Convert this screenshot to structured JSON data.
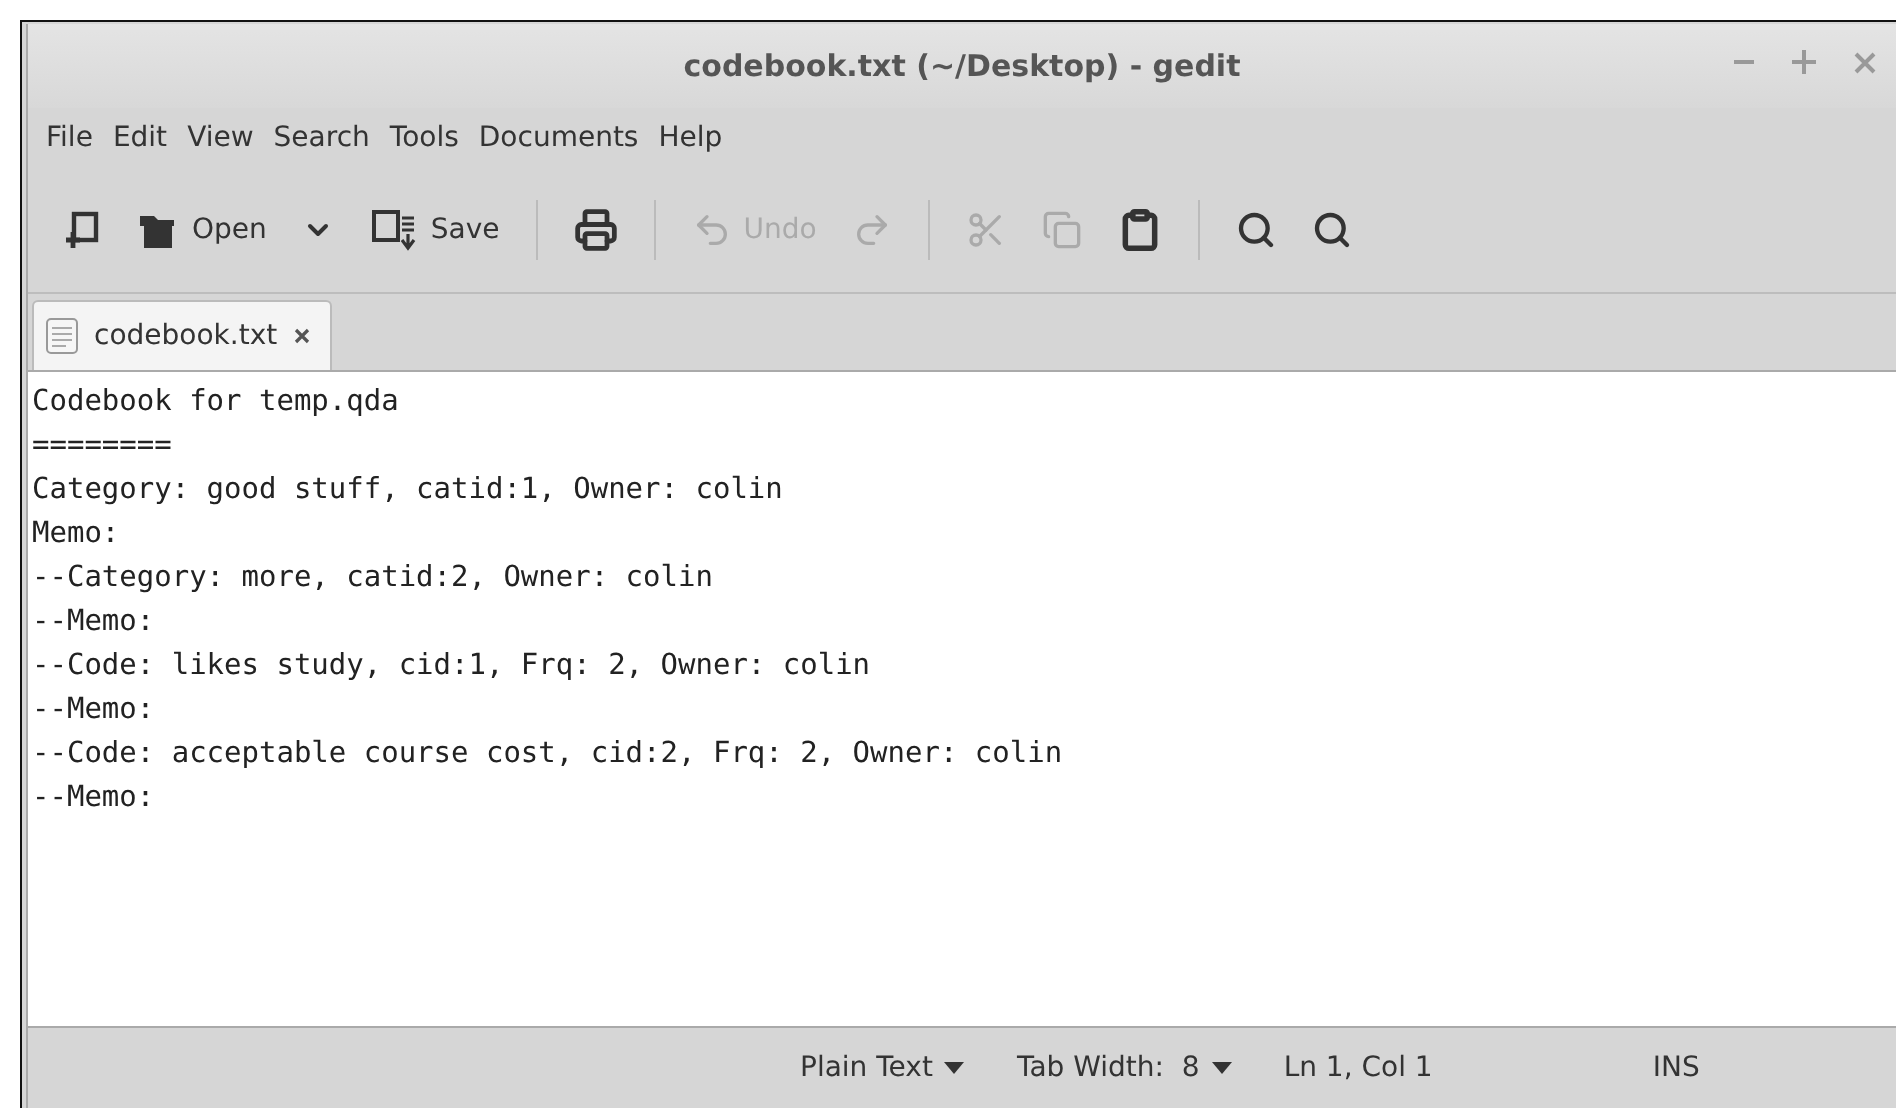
{
  "window": {
    "title": "codebook.txt (~/Desktop) - gedit"
  },
  "menu": [
    "File",
    "Edit",
    "View",
    "Search",
    "Tools",
    "Documents",
    "Help"
  ],
  "toolbar": [
    {
      "kind": "new",
      "disabled": false
    },
    {
      "kind": "open",
      "label": "Open",
      "disabled": false
    },
    {
      "kind": "dropdown",
      "disabled": false
    },
    {
      "kind": "save",
      "label": "Save",
      "disabled": false
    },
    {
      "kind": "separator"
    },
    {
      "kind": "print",
      "disabled": false
    },
    {
      "kind": "separator"
    },
    {
      "kind": "undo",
      "label": "Undo",
      "disabled": true
    },
    {
      "kind": "redo",
      "disabled": true
    },
    {
      "kind": "separator"
    },
    {
      "kind": "cut",
      "disabled": true
    },
    {
      "kind": "copy",
      "disabled": true
    },
    {
      "kind": "paste",
      "disabled": false
    },
    {
      "kind": "separator"
    },
    {
      "kind": "find",
      "disabled": false
    },
    {
      "kind": "replace",
      "disabled": false
    }
  ],
  "tabs": [
    {
      "label": "codebook.txt",
      "selected": true
    }
  ],
  "editor": {
    "lines": [
      "Codebook for temp.qda",
      "========",
      "Category: good stuff, catid:1, Owner: colin",
      "Memo:",
      "--Category: more, catid:2, Owner: colin",
      "--Memo:",
      "--Code: likes study, cid:1, Frq: 2, Owner: colin",
      "--Memo:",
      "--Code: acceptable course cost, cid:2, Frq: 2, Owner: colin",
      "--Memo:"
    ]
  },
  "status_bar": {
    "language": "Plain Text",
    "tab_width": "Tab Width:  8",
    "position": "Ln 1, Col 1",
    "mode": "INS"
  }
}
